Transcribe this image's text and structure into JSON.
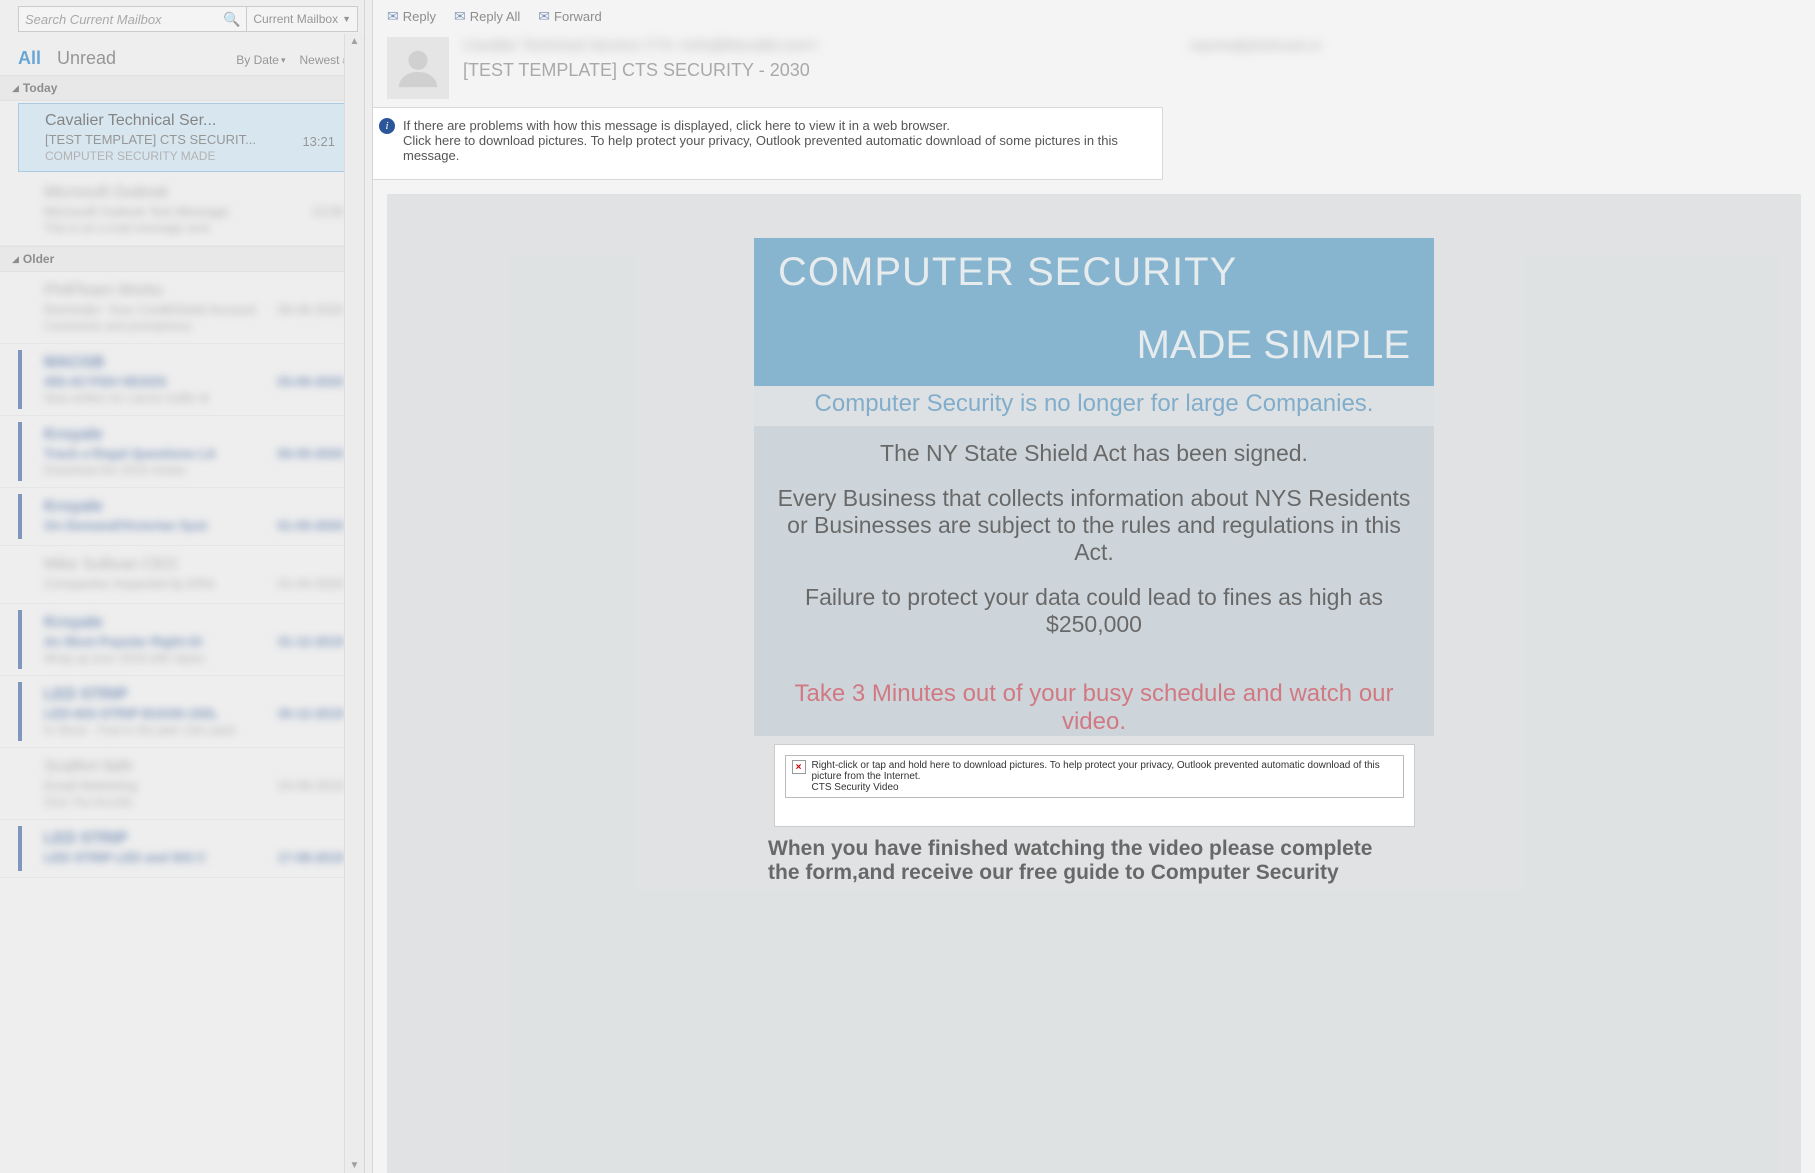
{
  "search": {
    "placeholder": "Search Current Mailbox",
    "scope": "Current Mailbox"
  },
  "tabs": {
    "all": "All",
    "unread": "Unread",
    "sort": "By Date",
    "order": "Newest"
  },
  "groups": {
    "today": "Today",
    "older": "Older"
  },
  "selected_msg": {
    "sender": "Cavalier Technical Ser...",
    "subject": "[TEST TEMPLATE] CTS SECURIT...",
    "preview": "COMPUTER SECURITY  MADE",
    "time": "13:21"
  },
  "actions": {
    "reply": "Reply",
    "reply_all": "Reply All",
    "forward": "Forward"
  },
  "reading": {
    "from": "Cavalier Technical Service CTS <info@thecabit.com>",
    "to": "reports@phishcam.io",
    "subject": "[TEST TEMPLATE] CTS SECURITY - 2030",
    "info1": "If there are problems with how this message is displayed, click here to view it in a web browser.",
    "info2": "Click here to download pictures. To help protect your privacy, Outlook prevented automatic download of some pictures in this message."
  },
  "email": {
    "hero1": "COMPUTER SECURITY",
    "hero2": "MADE SIMPLE",
    "subhead": "Computer Security is no longer for large Companies.",
    "p1": "The NY State Shield Act has been signed.",
    "p2": "Every Business that collects information about NYS Residents or Businesses   are subject to the rules and regulations in this Act.",
    "p3": "Failure to protect your data could lead to fines as high as  $250,000",
    "cta": "Take 3 Minutes out of your busy schedule and watch our video.",
    "img_alt1": "Right-click or tap and hold here to download pictures. To help protect your privacy, Outlook prevented automatic download of this picture from the Internet.",
    "img_alt2": "CTS Security Video",
    "after": "When you have finished watching the video please complete the form,and receive our free guide to Computer Security"
  },
  "blurred": [
    {
      "sender": "Microsoft Outlook",
      "subject": "Microsoft Outlook Test Message",
      "preview": "This is an e-mail message sent",
      "time": "13:06"
    },
    {
      "sender": "PhillTeam Works",
      "subject": "Reminder: Your Credit/Debit Account",
      "preview": "Comments and promptness",
      "time": "06-06-2020"
    },
    {
      "sender": "MACGB",
      "subject": "450-43 FISH HEADS",
      "preview": "New written for Larson traffic lit",
      "time": "03-06-2020",
      "unread": true
    },
    {
      "sender": "Kroyale",
      "subject": "Track a Regal Questions LA",
      "preview": "Download the 2019 review",
      "time": "06-05-2020",
      "unread": true
    },
    {
      "sender": "Kroyale",
      "subject": "On Demand/Victorian Syst",
      "preview": "",
      "time": "01-05-2020",
      "unread": true
    },
    {
      "sender": "Mike Sullivan CEO",
      "subject": "Companies Impacted by ERA",
      "preview": "",
      "time": "01-04-2020"
    },
    {
      "sender": "Kroyale",
      "subject": "An Most Popular Right-Gl",
      "preview": "Wrap up your 2019 with Sparx",
      "time": "31-12-2019",
      "unread": true
    },
    {
      "sender": "LED STRIP",
      "subject": "LED-602-STRIP B10/30-150L",
      "preview": "In Stock - Fast in the plan 10m pack",
      "time": "30-12-2019",
      "unread": true
    },
    {
      "sender": "Scalfert faith",
      "subject": "Email Marketing",
      "preview": "Give You Accelis",
      "time": "24-09-2019"
    },
    {
      "sender": "LED STRIP",
      "subject": "LED STRIP LED and 503 C",
      "preview": "",
      "time": "17-08-2019",
      "unread": true
    }
  ]
}
